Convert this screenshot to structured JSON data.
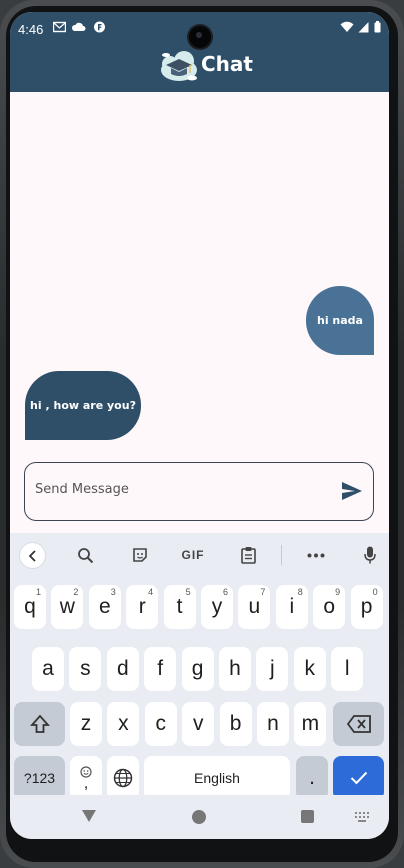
{
  "status_bar": {
    "time": "4:46",
    "left_icons": [
      "mail-icon",
      "cloud-icon",
      "app-notification-icon"
    ],
    "right_icons": [
      "wifi-icon",
      "signal-icon",
      "battery-icon"
    ]
  },
  "header": {
    "title": "Chat",
    "logo_icon": "graduation-cap-cloud-logo",
    "background": "#2f4f69"
  },
  "messages": [
    {
      "direction": "sent",
      "text": "hi nada",
      "color": "#4a7196"
    },
    {
      "direction": "received",
      "text": "hi , how are you?",
      "color": "#2f4f69"
    }
  ],
  "composer": {
    "placeholder": "Send Message",
    "value": "",
    "send_icon": "send-icon"
  },
  "keyboard": {
    "toolbar": {
      "gif_label": "GIF",
      "icons": [
        "chevron-left-icon",
        "search-icon",
        "sticker-icon",
        "gif-icon",
        "clipboard-icon",
        "more-icon",
        "mic-icon"
      ]
    },
    "row1": [
      {
        "k": "q",
        "h": "1"
      },
      {
        "k": "w",
        "h": "2"
      },
      {
        "k": "e",
        "h": "3"
      },
      {
        "k": "r",
        "h": "4"
      },
      {
        "k": "t",
        "h": "5"
      },
      {
        "k": "y",
        "h": "6"
      },
      {
        "k": "u",
        "h": "7"
      },
      {
        "k": "i",
        "h": "8"
      },
      {
        "k": "o",
        "h": "9"
      },
      {
        "k": "p",
        "h": "0"
      }
    ],
    "row2": [
      "a",
      "s",
      "d",
      "f",
      "g",
      "h",
      "j",
      "k",
      "l"
    ],
    "row3": [
      "z",
      "x",
      "c",
      "v",
      "b",
      "n",
      "m"
    ],
    "symbols_label": "?123",
    "comma_label": ",",
    "space_label": "English",
    "period_label": ".",
    "accent_color": "#2d6bd8"
  },
  "navbar": {
    "icons": [
      "nav-back-icon",
      "nav-home-icon",
      "nav-recents-icon",
      "keyboard-switch-icon"
    ]
  }
}
